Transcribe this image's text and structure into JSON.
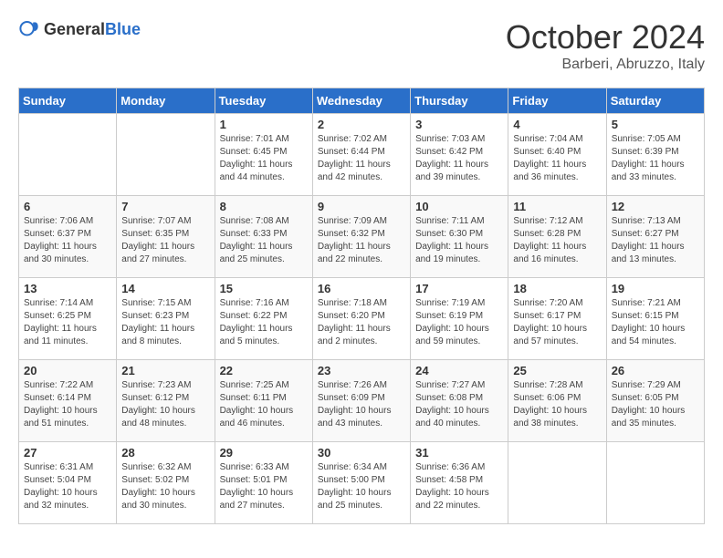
{
  "header": {
    "logo_general": "General",
    "logo_blue": "Blue",
    "month": "October 2024",
    "location": "Barberi, Abruzzo, Italy"
  },
  "weekdays": [
    "Sunday",
    "Monday",
    "Tuesday",
    "Wednesday",
    "Thursday",
    "Friday",
    "Saturday"
  ],
  "weeks": [
    [
      {
        "day": "",
        "info": ""
      },
      {
        "day": "",
        "info": ""
      },
      {
        "day": "1",
        "info": "Sunrise: 7:01 AM\nSunset: 6:45 PM\nDaylight: 11 hours and 44 minutes."
      },
      {
        "day": "2",
        "info": "Sunrise: 7:02 AM\nSunset: 6:44 PM\nDaylight: 11 hours and 42 minutes."
      },
      {
        "day": "3",
        "info": "Sunrise: 7:03 AM\nSunset: 6:42 PM\nDaylight: 11 hours and 39 minutes."
      },
      {
        "day": "4",
        "info": "Sunrise: 7:04 AM\nSunset: 6:40 PM\nDaylight: 11 hours and 36 minutes."
      },
      {
        "day": "5",
        "info": "Sunrise: 7:05 AM\nSunset: 6:39 PM\nDaylight: 11 hours and 33 minutes."
      }
    ],
    [
      {
        "day": "6",
        "info": "Sunrise: 7:06 AM\nSunset: 6:37 PM\nDaylight: 11 hours and 30 minutes."
      },
      {
        "day": "7",
        "info": "Sunrise: 7:07 AM\nSunset: 6:35 PM\nDaylight: 11 hours and 27 minutes."
      },
      {
        "day": "8",
        "info": "Sunrise: 7:08 AM\nSunset: 6:33 PM\nDaylight: 11 hours and 25 minutes."
      },
      {
        "day": "9",
        "info": "Sunrise: 7:09 AM\nSunset: 6:32 PM\nDaylight: 11 hours and 22 minutes."
      },
      {
        "day": "10",
        "info": "Sunrise: 7:11 AM\nSunset: 6:30 PM\nDaylight: 11 hours and 19 minutes."
      },
      {
        "day": "11",
        "info": "Sunrise: 7:12 AM\nSunset: 6:28 PM\nDaylight: 11 hours and 16 minutes."
      },
      {
        "day": "12",
        "info": "Sunrise: 7:13 AM\nSunset: 6:27 PM\nDaylight: 11 hours and 13 minutes."
      }
    ],
    [
      {
        "day": "13",
        "info": "Sunrise: 7:14 AM\nSunset: 6:25 PM\nDaylight: 11 hours and 11 minutes."
      },
      {
        "day": "14",
        "info": "Sunrise: 7:15 AM\nSunset: 6:23 PM\nDaylight: 11 hours and 8 minutes."
      },
      {
        "day": "15",
        "info": "Sunrise: 7:16 AM\nSunset: 6:22 PM\nDaylight: 11 hours and 5 minutes."
      },
      {
        "day": "16",
        "info": "Sunrise: 7:18 AM\nSunset: 6:20 PM\nDaylight: 11 hours and 2 minutes."
      },
      {
        "day": "17",
        "info": "Sunrise: 7:19 AM\nSunset: 6:19 PM\nDaylight: 10 hours and 59 minutes."
      },
      {
        "day": "18",
        "info": "Sunrise: 7:20 AM\nSunset: 6:17 PM\nDaylight: 10 hours and 57 minutes."
      },
      {
        "day": "19",
        "info": "Sunrise: 7:21 AM\nSunset: 6:15 PM\nDaylight: 10 hours and 54 minutes."
      }
    ],
    [
      {
        "day": "20",
        "info": "Sunrise: 7:22 AM\nSunset: 6:14 PM\nDaylight: 10 hours and 51 minutes."
      },
      {
        "day": "21",
        "info": "Sunrise: 7:23 AM\nSunset: 6:12 PM\nDaylight: 10 hours and 48 minutes."
      },
      {
        "day": "22",
        "info": "Sunrise: 7:25 AM\nSunset: 6:11 PM\nDaylight: 10 hours and 46 minutes."
      },
      {
        "day": "23",
        "info": "Sunrise: 7:26 AM\nSunset: 6:09 PM\nDaylight: 10 hours and 43 minutes."
      },
      {
        "day": "24",
        "info": "Sunrise: 7:27 AM\nSunset: 6:08 PM\nDaylight: 10 hours and 40 minutes."
      },
      {
        "day": "25",
        "info": "Sunrise: 7:28 AM\nSunset: 6:06 PM\nDaylight: 10 hours and 38 minutes."
      },
      {
        "day": "26",
        "info": "Sunrise: 7:29 AM\nSunset: 6:05 PM\nDaylight: 10 hours and 35 minutes."
      }
    ],
    [
      {
        "day": "27",
        "info": "Sunrise: 6:31 AM\nSunset: 5:04 PM\nDaylight: 10 hours and 32 minutes."
      },
      {
        "day": "28",
        "info": "Sunrise: 6:32 AM\nSunset: 5:02 PM\nDaylight: 10 hours and 30 minutes."
      },
      {
        "day": "29",
        "info": "Sunrise: 6:33 AM\nSunset: 5:01 PM\nDaylight: 10 hours and 27 minutes."
      },
      {
        "day": "30",
        "info": "Sunrise: 6:34 AM\nSunset: 5:00 PM\nDaylight: 10 hours and 25 minutes."
      },
      {
        "day": "31",
        "info": "Sunrise: 6:36 AM\nSunset: 4:58 PM\nDaylight: 10 hours and 22 minutes."
      },
      {
        "day": "",
        "info": ""
      },
      {
        "day": "",
        "info": ""
      }
    ]
  ]
}
